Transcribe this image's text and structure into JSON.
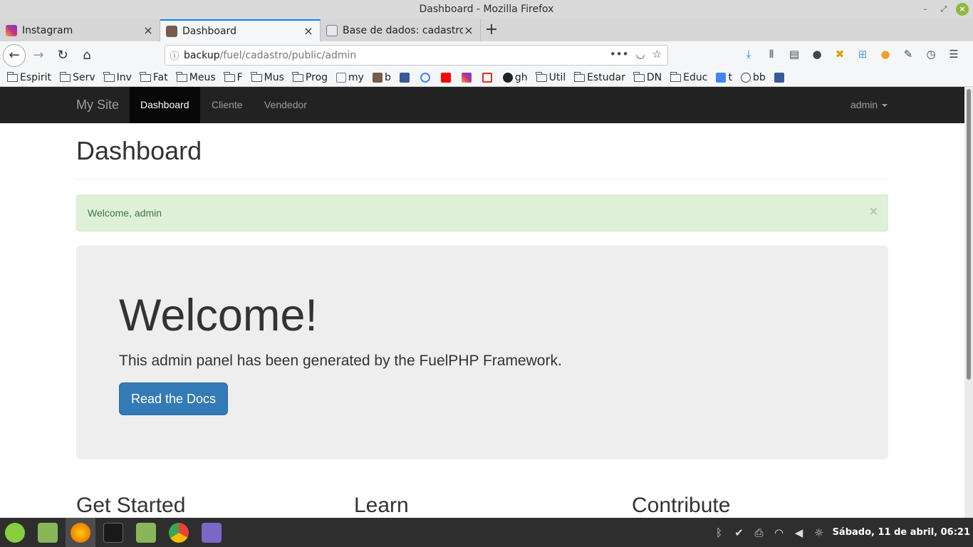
{
  "window": {
    "title": "Dashboard - Mozilla Firefox"
  },
  "tabs": [
    {
      "title": "Instagram",
      "icon": "instagram-icon",
      "color": "#c13584"
    },
    {
      "title": "Dashboard",
      "icon": "avatar-icon",
      "color": "#7a5a4a",
      "active": true
    },
    {
      "title": "Base de dados: cadastro",
      "icon": "phpmyadmin-icon",
      "color": "#6c78af"
    }
  ],
  "urlbar": {
    "host": "backup",
    "path": "/fuel/cadastro/public/admin"
  },
  "bookmarks": [
    {
      "label": "Espirit",
      "type": "folder"
    },
    {
      "label": "Serv",
      "type": "folder"
    },
    {
      "label": "Inv",
      "type": "folder"
    },
    {
      "label": "Fat",
      "type": "folder"
    },
    {
      "label": "Meus",
      "type": "folder"
    },
    {
      "label": "F",
      "type": "folder"
    },
    {
      "label": "Mus",
      "type": "folder"
    },
    {
      "label": "Prog",
      "type": "folder"
    },
    {
      "label": "my",
      "type": "link",
      "color": "#6c78af"
    },
    {
      "label": "b",
      "type": "link",
      "color": "#7a5a4a"
    },
    {
      "label": "",
      "type": "link",
      "color": "#3b5998"
    },
    {
      "label": "",
      "type": "link",
      "color": "#4285f4"
    },
    {
      "label": "",
      "type": "link",
      "color": "#ff0000"
    },
    {
      "label": "",
      "type": "link",
      "color": "#c13584"
    },
    {
      "label": "",
      "type": "link",
      "color": "#d93025"
    },
    {
      "label": "gh",
      "type": "link",
      "color": "#222222"
    },
    {
      "label": "Util",
      "type": "folder"
    },
    {
      "label": "Estudar",
      "type": "folder"
    },
    {
      "label": "DN",
      "type": "folder"
    },
    {
      "label": "Educ",
      "type": "folder"
    },
    {
      "label": "t",
      "type": "link",
      "color": "#4285f4"
    },
    {
      "label": "bb",
      "type": "link",
      "color": "#444444"
    },
    {
      "label": "",
      "type": "link",
      "color": "#3b5998"
    }
  ],
  "site": {
    "brand": "My Site",
    "nav": [
      "Dashboard",
      "Cliente",
      "Vendedor"
    ],
    "user": "admin"
  },
  "page": {
    "title": "Dashboard",
    "alert": "Welcome, admin",
    "alert_close": "×",
    "jumbo_title": "Welcome!",
    "jumbo_text": "This admin panel has been generated by the FuelPHP Framework.",
    "jumbo_button": "Read the Docs",
    "columns": [
      "Get Started",
      "Learn",
      "Contribute"
    ]
  },
  "taskbar": {
    "clock": "Sábado, 11 de abril, 06:21",
    "apps": [
      {
        "name": "mint-menu",
        "color": "#87cf3e"
      },
      {
        "name": "files",
        "color": "#8ab65a"
      },
      {
        "name": "firefox",
        "color": "#e66000",
        "active": true
      },
      {
        "name": "terminal",
        "color": "#1a1a1a"
      },
      {
        "name": "folder",
        "color": "#8ab65a"
      },
      {
        "name": "chrome",
        "color": "#4285f4"
      },
      {
        "name": "text-editor",
        "color": "#7b68c6"
      }
    ]
  }
}
